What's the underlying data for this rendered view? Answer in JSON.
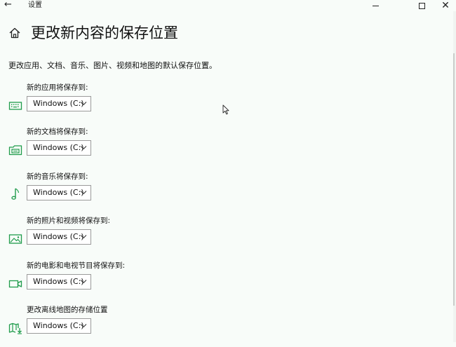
{
  "window": {
    "back_glyph": "←",
    "title": "设置",
    "minimize_glyph": "—",
    "maximize_glyph": "□",
    "close_glyph": "✕"
  },
  "page": {
    "title": "更改新内容的保存位置",
    "description": "更改应用、文档、音乐、图片、视频和地图的默认保存位置。"
  },
  "accent_color": "#1f9b4b",
  "settings": [
    {
      "label": "新的应用将保存到:",
      "value": "Windows (C:)",
      "icon": "keyboard-icon"
    },
    {
      "label": "新的文档将保存到:",
      "value": "Windows (C:)",
      "icon": "document-drive-icon"
    },
    {
      "label": "新的音乐将保存到:",
      "value": "Windows (C:)",
      "icon": "music-note-icon"
    },
    {
      "label": "新的照片和视频将保存到:",
      "value": "Windows (C:)",
      "icon": "photo-icon"
    },
    {
      "label": "新的电影和电视节目将保存到:",
      "value": "Windows (C:)",
      "icon": "video-camera-icon"
    },
    {
      "label": "更改离线地图的存储位置",
      "value": "Windows (C:)",
      "icon": "map-download-icon"
    }
  ]
}
